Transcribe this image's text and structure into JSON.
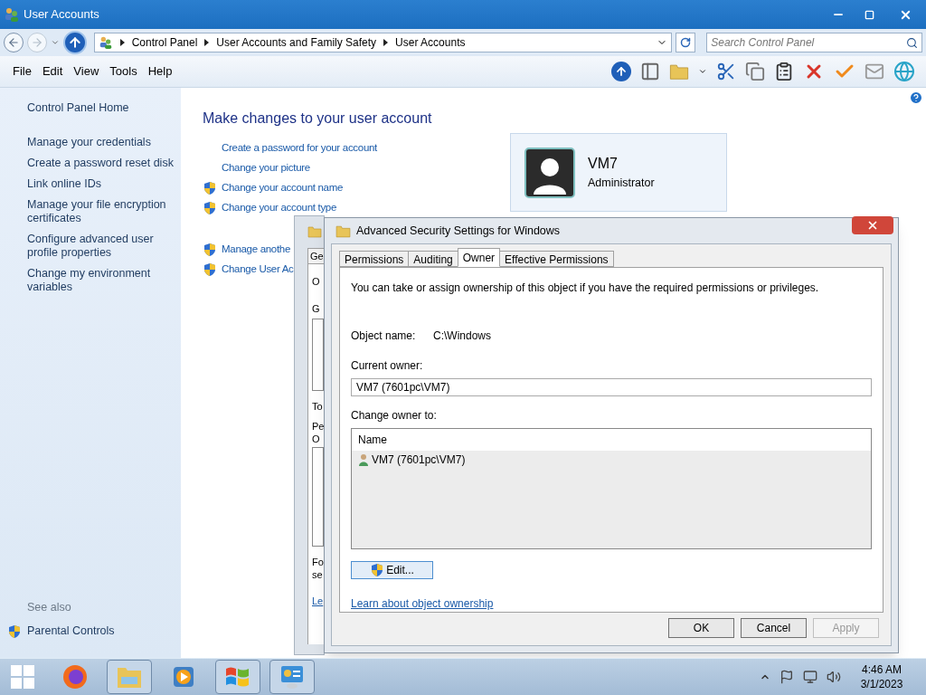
{
  "window": {
    "title": "User Accounts"
  },
  "nav": {
    "breadcrumb": [
      "Control Panel",
      "User Accounts and Family Safety",
      "User Accounts"
    ],
    "search_placeholder": "Search Control Panel"
  },
  "menu": [
    "File",
    "Edit",
    "View",
    "Tools",
    "Help"
  ],
  "sidebar": {
    "home": "Control Panel Home",
    "links": [
      "Manage your credentials",
      "Create a password reset disk",
      "Link online IDs",
      "Manage your file encryption certificates",
      "Configure advanced user profile properties",
      "Change my environment variables"
    ],
    "see_also": "See also",
    "see_also_links": [
      {
        "label": "Parental Controls",
        "shield": true
      }
    ]
  },
  "main": {
    "heading": "Make changes to your user account",
    "tasks": [
      {
        "label": "Create a password for your account",
        "shield": false
      },
      {
        "label": "Change your picture",
        "shield": false
      },
      {
        "label": "Change your account name",
        "shield": true
      },
      {
        "label": "Change your account type",
        "shield": true
      }
    ],
    "tasks2": [
      {
        "label": "Manage anothe",
        "shield": true
      },
      {
        "label": "Change User Ac",
        "shield": true
      }
    ],
    "account": {
      "name": "VM7",
      "role": "Administrator"
    }
  },
  "back_dialog": {
    "tab": "Ge",
    "fragments": [
      {
        "text": "O",
        "kind": "label"
      },
      {
        "text": "G",
        "kind": "label"
      },
      {
        "kind": "box"
      },
      {
        "text": "To",
        "kind": "label"
      },
      {
        "text": "Pe",
        "kind": "label"
      },
      {
        "text": "O",
        "kind": "label"
      },
      {
        "kind": "box"
      },
      {
        "text": "Fo",
        "kind": "label"
      },
      {
        "text": "se",
        "kind": "label"
      },
      {
        "text": "Le",
        "kind": "link"
      }
    ]
  },
  "dialog": {
    "title": "Advanced Security Settings for Windows",
    "tabs": [
      {
        "label": "Permissions",
        "selected": false
      },
      {
        "label": "Auditing",
        "selected": false
      },
      {
        "label": "Owner",
        "selected": true
      },
      {
        "label": "Effective Permissions",
        "selected": false
      }
    ],
    "intro": "You can take or assign ownership of this object if you have the required permissions or privileges.",
    "object_label": "Object name:",
    "object_value": "C:\\Windows",
    "current_owner_label": "Current owner:",
    "current_owner_value": "VM7 (7601pc\\VM7)",
    "change_owner_label": "Change owner to:",
    "list_header": "Name",
    "owners": [
      {
        "name": "VM7 (7601pc\\VM7)"
      }
    ],
    "edit_button": "Edit...",
    "link": "Learn about object ownership",
    "buttons": [
      {
        "label": "OK",
        "disabled": false
      },
      {
        "label": "Cancel",
        "disabled": false
      },
      {
        "label": "Apply",
        "disabled": true
      }
    ]
  },
  "taskbar": {
    "apps": [
      {
        "kind": "firefox",
        "running": false
      },
      {
        "kind": "explorer",
        "running": true
      },
      {
        "kind": "media",
        "running": false
      },
      {
        "kind": "windows",
        "running": true
      },
      {
        "kind": "control-panel",
        "running": true
      }
    ],
    "time": "4:46 AM",
    "date": "3/1/2023"
  }
}
